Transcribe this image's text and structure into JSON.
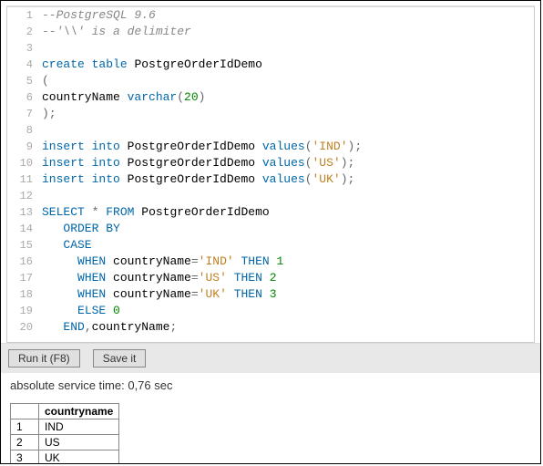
{
  "code": {
    "lines": [
      {
        "n": 1,
        "segs": [
          {
            "c": "t-comment",
            "t": "--PostgreSQL 9.6"
          }
        ]
      },
      {
        "n": 2,
        "segs": [
          {
            "c": "t-comment",
            "t": "--'\\\\' is a delimiter"
          }
        ]
      },
      {
        "n": 3,
        "segs": []
      },
      {
        "n": 4,
        "segs": [
          {
            "c": "t-keyword",
            "t": "create"
          },
          {
            "c": "t-ident",
            "t": " "
          },
          {
            "c": "t-keyword",
            "t": "table"
          },
          {
            "c": "t-ident",
            "t": " PostgreOrderIdDemo"
          }
        ]
      },
      {
        "n": 5,
        "segs": [
          {
            "c": "t-punc",
            "t": "("
          }
        ]
      },
      {
        "n": 6,
        "segs": [
          {
            "c": "t-ident",
            "t": "countryName "
          },
          {
            "c": "t-keyword",
            "t": "varchar"
          },
          {
            "c": "t-punc",
            "t": "("
          },
          {
            "c": "t-number",
            "t": "20"
          },
          {
            "c": "t-punc",
            "t": ")"
          }
        ]
      },
      {
        "n": 7,
        "segs": [
          {
            "c": "t-punc",
            "t": ");"
          }
        ]
      },
      {
        "n": 8,
        "segs": []
      },
      {
        "n": 9,
        "segs": [
          {
            "c": "t-keyword",
            "t": "insert"
          },
          {
            "c": "t-ident",
            "t": " "
          },
          {
            "c": "t-keyword",
            "t": "into"
          },
          {
            "c": "t-ident",
            "t": " PostgreOrderIdDemo "
          },
          {
            "c": "t-keyword",
            "t": "values"
          },
          {
            "c": "t-punc",
            "t": "("
          },
          {
            "c": "t-string",
            "t": "'IND'"
          },
          {
            "c": "t-punc",
            "t": ");"
          }
        ]
      },
      {
        "n": 10,
        "segs": [
          {
            "c": "t-keyword",
            "t": "insert"
          },
          {
            "c": "t-ident",
            "t": " "
          },
          {
            "c": "t-keyword",
            "t": "into"
          },
          {
            "c": "t-ident",
            "t": " PostgreOrderIdDemo "
          },
          {
            "c": "t-keyword",
            "t": "values"
          },
          {
            "c": "t-punc",
            "t": "("
          },
          {
            "c": "t-string",
            "t": "'US'"
          },
          {
            "c": "t-punc",
            "t": ");"
          }
        ]
      },
      {
        "n": 11,
        "segs": [
          {
            "c": "t-keyword",
            "t": "insert"
          },
          {
            "c": "t-ident",
            "t": " "
          },
          {
            "c": "t-keyword",
            "t": "into"
          },
          {
            "c": "t-ident",
            "t": " PostgreOrderIdDemo "
          },
          {
            "c": "t-keyword",
            "t": "values"
          },
          {
            "c": "t-punc",
            "t": "("
          },
          {
            "c": "t-string",
            "t": "'UK'"
          },
          {
            "c": "t-punc",
            "t": ");"
          }
        ]
      },
      {
        "n": 12,
        "segs": []
      },
      {
        "n": 13,
        "segs": [
          {
            "c": "t-keyword",
            "t": "SELECT"
          },
          {
            "c": "t-ident",
            "t": " "
          },
          {
            "c": "t-punc",
            "t": "*"
          },
          {
            "c": "t-ident",
            "t": " "
          },
          {
            "c": "t-keyword",
            "t": "FROM"
          },
          {
            "c": "t-ident",
            "t": " PostgreOrderIdDemo"
          }
        ]
      },
      {
        "n": 14,
        "segs": [
          {
            "c": "t-ident",
            "t": "   "
          },
          {
            "c": "t-keyword",
            "t": "ORDER BY"
          }
        ]
      },
      {
        "n": 15,
        "segs": [
          {
            "c": "t-ident",
            "t": "   "
          },
          {
            "c": "t-keyword",
            "t": "CASE"
          }
        ]
      },
      {
        "n": 16,
        "segs": [
          {
            "c": "t-ident",
            "t": "     "
          },
          {
            "c": "t-keyword",
            "t": "WHEN"
          },
          {
            "c": "t-ident",
            "t": " countryName"
          },
          {
            "c": "t-punc",
            "t": "="
          },
          {
            "c": "t-string",
            "t": "'IND'"
          },
          {
            "c": "t-ident",
            "t": " "
          },
          {
            "c": "t-keyword",
            "t": "THEN"
          },
          {
            "c": "t-ident",
            "t": " "
          },
          {
            "c": "t-number",
            "t": "1"
          }
        ]
      },
      {
        "n": 17,
        "segs": [
          {
            "c": "t-ident",
            "t": "     "
          },
          {
            "c": "t-keyword",
            "t": "WHEN"
          },
          {
            "c": "t-ident",
            "t": " countryName"
          },
          {
            "c": "t-punc",
            "t": "="
          },
          {
            "c": "t-string",
            "t": "'US'"
          },
          {
            "c": "t-ident",
            "t": " "
          },
          {
            "c": "t-keyword",
            "t": "THEN"
          },
          {
            "c": "t-ident",
            "t": " "
          },
          {
            "c": "t-number",
            "t": "2"
          }
        ]
      },
      {
        "n": 18,
        "segs": [
          {
            "c": "t-ident",
            "t": "     "
          },
          {
            "c": "t-keyword",
            "t": "WHEN"
          },
          {
            "c": "t-ident",
            "t": " countryName"
          },
          {
            "c": "t-punc",
            "t": "="
          },
          {
            "c": "t-string",
            "t": "'UK'"
          },
          {
            "c": "t-ident",
            "t": " "
          },
          {
            "c": "t-keyword",
            "t": "THEN"
          },
          {
            "c": "t-ident",
            "t": " "
          },
          {
            "c": "t-number",
            "t": "3"
          }
        ]
      },
      {
        "n": 19,
        "segs": [
          {
            "c": "t-ident",
            "t": "     "
          },
          {
            "c": "t-keyword",
            "t": "ELSE"
          },
          {
            "c": "t-ident",
            "t": " "
          },
          {
            "c": "t-number",
            "t": "0"
          }
        ]
      },
      {
        "n": 20,
        "segs": [
          {
            "c": "t-ident",
            "t": "   "
          },
          {
            "c": "t-keyword",
            "t": "END"
          },
          {
            "c": "t-punc",
            "t": ","
          },
          {
            "c": "t-ident",
            "t": "countryName"
          },
          {
            "c": "t-punc",
            "t": ";"
          }
        ]
      }
    ]
  },
  "toolbar": {
    "run_label": "Run it (F8)",
    "save_label": "Save it"
  },
  "status": "absolute service time: 0,76 sec",
  "result": {
    "columns": [
      "countryname"
    ],
    "rows": [
      {
        "n": "1",
        "cells": [
          "IND"
        ]
      },
      {
        "n": "2",
        "cells": [
          "US"
        ]
      },
      {
        "n": "3",
        "cells": [
          "UK"
        ]
      }
    ]
  }
}
